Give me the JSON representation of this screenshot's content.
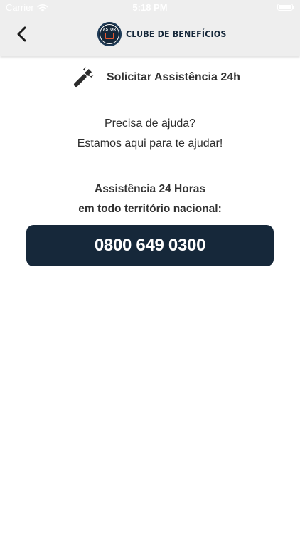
{
  "status_bar": {
    "carrier": "Carrier",
    "time": "5:18 PM"
  },
  "header": {
    "logo_badge_text": "ASTOR",
    "logo_text": "CLUBE DE BENEFÍCIOS",
    "back_icon": "chevron-left-icon"
  },
  "main": {
    "title": "Solicitar Assistência 24h",
    "title_icon": "wrench-icon",
    "help_line1": "Precisa de ajuda?",
    "help_line2": "Estamos aqui para te ajudar!",
    "assist_line1": "Assistência 24 Horas",
    "assist_line2": "em todo território nacional:",
    "phone_number": "0800 649 0300"
  },
  "colors": {
    "brand_navy": "#16283a",
    "accent_orange": "#e4572e",
    "header_bg": "#eeeeee"
  }
}
